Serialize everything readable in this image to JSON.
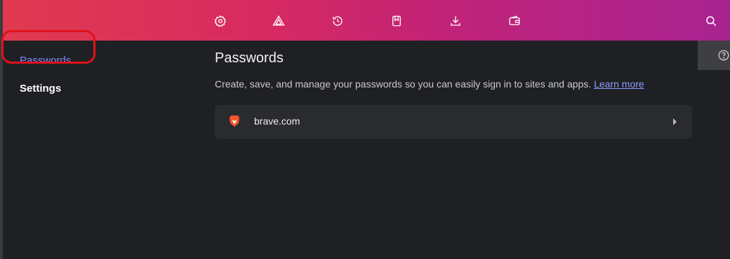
{
  "toolbar": {
    "icons": [
      "settings-icon",
      "brave-rewards-icon",
      "history-icon",
      "bookmarks-icon",
      "downloads-icon",
      "wallet-icon",
      "search-icon"
    ]
  },
  "sidebar": {
    "items": [
      {
        "label": "Passwords",
        "active": true
      },
      {
        "label": "Settings",
        "active": false
      }
    ],
    "highlight_color": "#e0121c"
  },
  "main": {
    "title": "Passwords",
    "description": "Create, save, and manage your passwords so you can easily sign in to sites and apps.",
    "learn_more": "Learn more",
    "entries": [
      {
        "site": "brave.com",
        "icon": "brave-lion-icon"
      }
    ]
  },
  "help": {
    "icon": "help-icon"
  },
  "colors": {
    "accent": "#7c8cff",
    "background": "#1f2023",
    "row": "#2a2b2f",
    "topbar_start": "#e13a50",
    "topbar_end": "#a72391"
  }
}
